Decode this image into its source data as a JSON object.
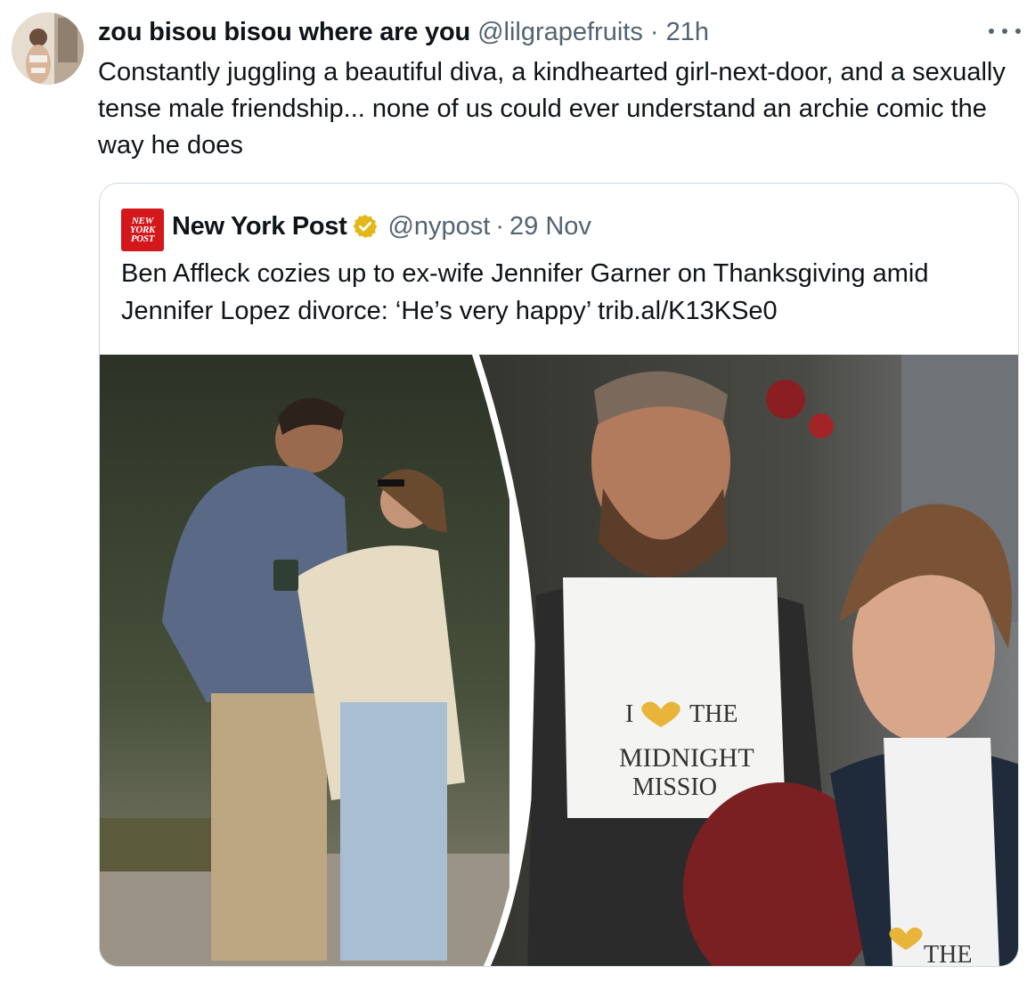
{
  "tweet": {
    "display_name": "zou bisou bisou where are you",
    "handle": "@lilgrapefruits",
    "separator": "·",
    "time": "21h",
    "text": "Constantly juggling a beautiful diva, a kindhearted girl-next-door, and a sexually tense male friendship... none of us could ever understand an archie comic the way he does",
    "more_icon": "more-horizontal-icon"
  },
  "quote": {
    "logo_lines": [
      "NEW",
      "YORK",
      "POST"
    ],
    "display_name": "New York Post",
    "verified_icon": "verified-gold-badge-icon",
    "handle": "@nypost",
    "separator": "·",
    "date": "29 Nov",
    "text": "Ben Affleck cozies up to ex-wife Jennifer Garner on Thanksgiving amid Jennifer Lopez divorce: ‘He’s very happy’ trib.al/K13KSe0",
    "apron_texts": {
      "line1_left": "I",
      "line1_right": "THE",
      "line2": "MIDNIGHT",
      "line3": "MISSIO",
      "bottom": "THE"
    }
  },
  "colors": {
    "text": "#0f1419",
    "secondary": "#536471",
    "border": "#cfd9de",
    "nypost_red": "#d3171b",
    "verified_gold": "#e2b719"
  }
}
